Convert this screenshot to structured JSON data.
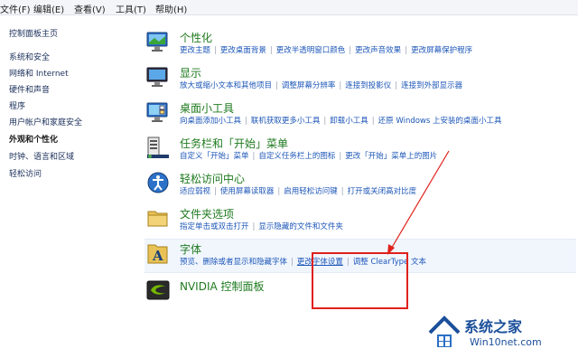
{
  "menu": [
    "文件(F)",
    "编辑(E)",
    "查看(V)",
    "工具(T)",
    "帮助(H)"
  ],
  "sidebar": {
    "home": "控制面板主页",
    "items": [
      {
        "label": "系统和安全"
      },
      {
        "label": "网络和 Internet"
      },
      {
        "label": "硬件和声音"
      },
      {
        "label": "程序"
      },
      {
        "label": "用户帐户和家庭安全"
      },
      {
        "label": "外观和个性化",
        "active": true
      },
      {
        "label": "时钟、语言和区域"
      },
      {
        "label": "轻松访问"
      }
    ]
  },
  "categories": [
    {
      "title": "个性化",
      "icon": "personalization-icon",
      "links": [
        "更改主题",
        "更改桌面背景",
        "更改半透明窗口颜色",
        "更改声音效果",
        "更改屏幕保护程序"
      ]
    },
    {
      "title": "显示",
      "icon": "display-icon",
      "links": [
        "放大或缩小文本和其他项目",
        "调整屏幕分辨率",
        "连接到投影仪",
        "连接到外部显示器"
      ]
    },
    {
      "title": "桌面小工具",
      "icon": "gadgets-icon",
      "links": [
        "向桌面添加小工具",
        "联机获取更多小工具",
        "卸载小工具",
        "还原 Windows 上安装的桌面小工具"
      ]
    },
    {
      "title": "任务栏和「开始」菜单",
      "icon": "taskbar-icon",
      "links": [
        "自定义「开始」菜单",
        "自定义任务栏上的图标",
        "更改「开始」菜单上的图片"
      ]
    },
    {
      "title": "轻松访问中心",
      "icon": "ease-of-access-icon",
      "links": [
        "适应弱视",
        "使用屏幕读取器",
        "启用轻松访问键",
        "打开或关闭高对比度"
      ]
    },
    {
      "title": "文件夹选项",
      "icon": "folder-options-icon",
      "links": [
        "指定单击或双击打开",
        "显示隐藏的文件和文件夹"
      ]
    },
    {
      "title": "字体",
      "icon": "fonts-icon",
      "links": [
        "预览、删除或者显示和隐藏字体",
        "更改字体设置",
        "调整 ClearType 文本"
      ]
    },
    {
      "title": "NVIDIA 控制面板",
      "icon": "nvidia-icon",
      "links": []
    }
  ],
  "watermark": {
    "title": "系统之家",
    "sub": "Win10net.com"
  },
  "colors": {
    "accent_green": "#1e7a1e",
    "link_blue": "#1c56b8",
    "highlight_red": "#e0201a"
  }
}
